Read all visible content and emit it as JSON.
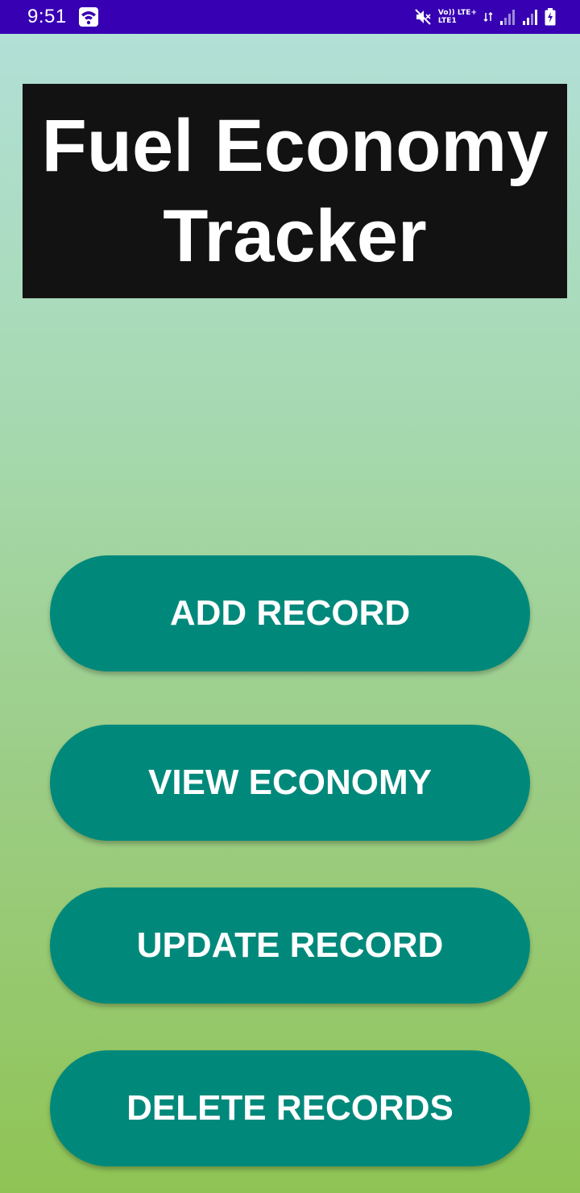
{
  "status_bar": {
    "time": "9:51",
    "network_line1": "Vo)) LTE+",
    "network_line2": "LTE1",
    "icons": [
      "wifi-icon",
      "mute-icon",
      "signal-icon",
      "signal-icon",
      "battery-charging-icon"
    ],
    "background_color": "#3700b3"
  },
  "header": {
    "title_line1": "Fuel Economy",
    "title_line2": "Tracker"
  },
  "menu": {
    "add_record": "ADD RECORD",
    "view_economy": "VIEW ECONOMY",
    "update_record": "UPDATE RECORD",
    "delete_records": "DELETE RECORDS"
  },
  "colors": {
    "button": "#00897b",
    "title_background": "#121212",
    "gradient_top": "#b3e0da",
    "gradient_bottom": "#8fc455"
  }
}
